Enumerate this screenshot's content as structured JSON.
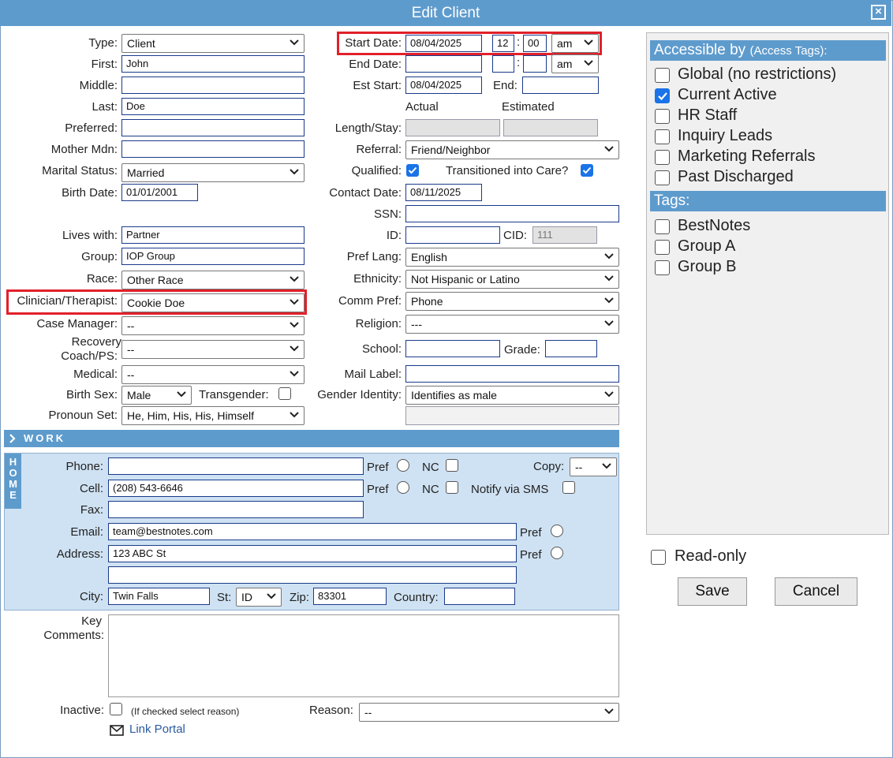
{
  "window": {
    "title": "Edit Client",
    "close": "×"
  },
  "left": {
    "type": {
      "label": "Type:",
      "value": "Client"
    },
    "first": {
      "label": "First:",
      "value": "John"
    },
    "middle": {
      "label": "Middle:",
      "value": ""
    },
    "last": {
      "label": "Last:",
      "value": "Doe"
    },
    "preferred": {
      "label": "Preferred:",
      "value": ""
    },
    "mother_mdn": {
      "label": "Mother Mdn:",
      "value": ""
    },
    "marital": {
      "label": "Marital Status:",
      "value": "Married"
    },
    "birth_date": {
      "label": "Birth Date:",
      "value": "01/01/2001"
    },
    "lives_with": {
      "label": "Lives with:",
      "value": "Partner"
    },
    "group": {
      "label": "Group:",
      "value": "IOP Group"
    },
    "race": {
      "label": "Race:",
      "value": "Other Race"
    },
    "clinician": {
      "label": "Clinician/Therapist:",
      "value": "Cookie Doe"
    },
    "case_manager": {
      "label": "Case Manager:",
      "value": "--"
    },
    "recovery": {
      "label1": "Recovery",
      "label2": "Coach/PS:",
      "value": "--"
    },
    "medical": {
      "label": "Medical:",
      "value": "--"
    },
    "birth_sex": {
      "label": "Birth Sex:",
      "value": "Male"
    },
    "transgender": {
      "label": "Transgender:"
    },
    "pronoun": {
      "label": "Pronoun Set:",
      "value": "He, Him, His, His, Himself"
    }
  },
  "mid": {
    "start_date": {
      "label": "Start Date:",
      "value": "08/04/2025",
      "hour": "12",
      "minute": "00",
      "ampm": "am"
    },
    "end_date": {
      "label": "End Date:",
      "value": "",
      "hour": "",
      "minute": "",
      "ampm": "am"
    },
    "est_start": {
      "label": "Est Start:",
      "value": "08/04/2025"
    },
    "end": {
      "label": "End:",
      "value": ""
    },
    "actual": "Actual",
    "estimated": "Estimated",
    "length_stay": {
      "label": "Length/Stay:"
    },
    "referral": {
      "label": "Referral:",
      "value": "Friend/Neighbor"
    },
    "qualified": {
      "label": "Qualified:"
    },
    "transitioned": {
      "label": "Transitioned into Care?"
    },
    "contact_date": {
      "label": "Contact Date:",
      "value": "08/11/2025"
    },
    "ssn": {
      "label": "SSN:",
      "value": ""
    },
    "id": {
      "label": "ID:",
      "value": ""
    },
    "cid": {
      "label": "CID:",
      "value": "111"
    },
    "pref_lang": {
      "label": "Pref Lang:",
      "value": "English"
    },
    "ethnicity": {
      "label": "Ethnicity:",
      "value": "Not Hispanic or Latino"
    },
    "comm_pref": {
      "label": "Comm Pref:",
      "value": "Phone"
    },
    "religion": {
      "label": "Religion:",
      "value": "---"
    },
    "school": {
      "label": "School:",
      "value": ""
    },
    "grade": {
      "label": "Grade:",
      "value": ""
    },
    "mail_label": {
      "label": "Mail Label:",
      "value": ""
    },
    "gender_identity": {
      "label": "Gender Identity:",
      "value": "Identifies as male"
    }
  },
  "work": {
    "label": "WORK"
  },
  "home": {
    "tab": "HOME",
    "phone": {
      "label": "Phone:",
      "value": ""
    },
    "cell": {
      "label": "Cell:",
      "value": "(208) 543-6646"
    },
    "fax": {
      "label": "Fax:",
      "value": ""
    },
    "email": {
      "label": "Email:",
      "value": "team@bestnotes.com"
    },
    "address": {
      "label": "Address:",
      "value": "123 ABC St",
      "value2": ""
    },
    "city": {
      "label": "City:",
      "value": "Twin Falls"
    },
    "st": {
      "label": "St:",
      "value": "ID"
    },
    "zip": {
      "label": "Zip:",
      "value": "83301"
    },
    "country": {
      "label": "Country:",
      "value": ""
    },
    "pref": "Pref",
    "nc": "NC",
    "copy": {
      "label": "Copy:",
      "value": "--"
    },
    "notify_sms": "Notify via SMS"
  },
  "bottom": {
    "key_comments1": "Key",
    "key_comments2": "Comments:",
    "inactive": "Inactive:",
    "inactive_note": "(If checked select reason)",
    "reason": {
      "label": "Reason:",
      "value": "--"
    },
    "link_portal": "Link Portal"
  },
  "right": {
    "accessible_title": "Accessible by",
    "accessible_sub": "(Access Tags):",
    "access_tags": [
      "Global (no restrictions)",
      "Current Active",
      "HR Staff",
      "Inquiry Leads",
      "Marketing Referrals",
      "Past Discharged"
    ],
    "tags_title": "Tags:",
    "tags": [
      "BestNotes",
      "Group A",
      "Group B"
    ],
    "read_only": "Read-only",
    "save": "Save",
    "cancel": "Cancel"
  },
  "colors": {
    "accent": "#5e9bcd",
    "highlight": "#e2202a",
    "home_bg": "#cfe2f3",
    "checkbox_on": "#1a73e8"
  }
}
